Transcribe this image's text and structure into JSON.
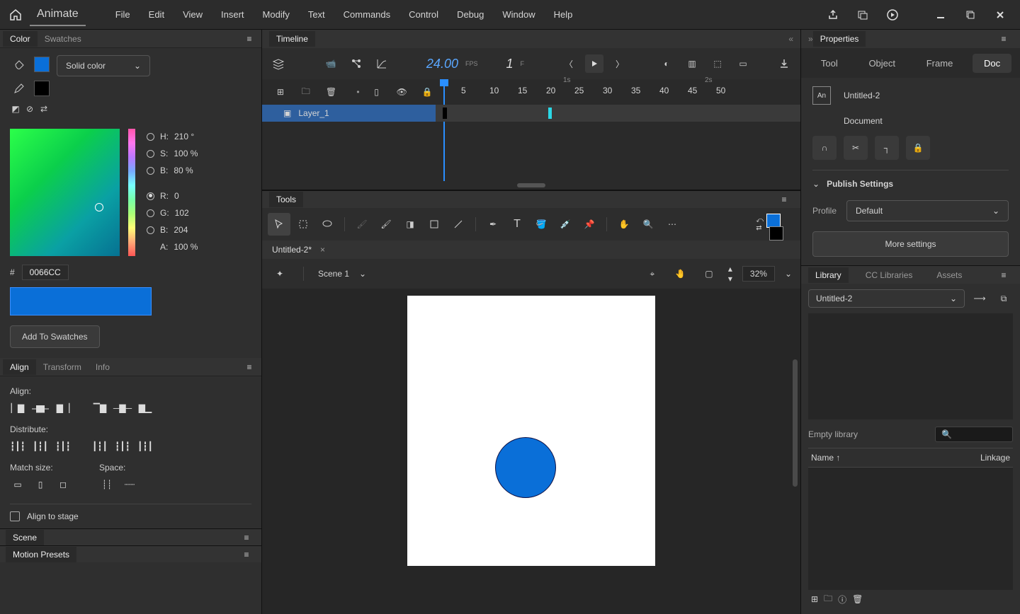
{
  "app": {
    "name": "Animate"
  },
  "menu": [
    "File",
    "Edit",
    "View",
    "Insert",
    "Modify",
    "Text",
    "Commands",
    "Control",
    "Debug",
    "Window",
    "Help"
  ],
  "color": {
    "panel_tab": "Color",
    "swatches_tab": "Swatches",
    "type": "Solid color",
    "hex_prefix": "#",
    "hex": "0066CC",
    "H_label": "H:",
    "H_val": "210 °",
    "S_label": "S:",
    "S_val": "100 %",
    "B_label": "B:",
    "B_val": "80 %",
    "R_label": "R:",
    "R_val": "0",
    "G_label": "G:",
    "G_val": "102",
    "Bch_label": "B:",
    "Bch_val": "204",
    "A_label": "A:",
    "A_val": "100 %",
    "add": "Add To Swatches"
  },
  "align": {
    "tab": "Align",
    "transform": "Transform",
    "info": "Info",
    "align_lbl": "Align:",
    "distribute_lbl": "Distribute:",
    "match_lbl": "Match size:",
    "space_lbl": "Space:",
    "stage": "Align to stage"
  },
  "scene": {
    "tab": "Scene"
  },
  "motion": {
    "tab": "Motion Presets"
  },
  "timeline": {
    "tab": "Timeline",
    "fps": "24.00",
    "fps_unit": "FPS",
    "frame": "1",
    "frame_unit": "F",
    "layer": "Layer_1",
    "marks": [
      "5",
      "10",
      "15",
      "20",
      "25",
      "30",
      "35",
      "40",
      "45",
      "50"
    ],
    "mark1s": "1s",
    "mark2s": "2s"
  },
  "tools": {
    "tab": "Tools"
  },
  "doc": {
    "tab": "Untitled-2*",
    "scene": "Scene 1",
    "zoom": "32%"
  },
  "props": {
    "tab": "Properties",
    "tool": "Tool",
    "object": "Object",
    "frame": "Frame",
    "doc": "Doc",
    "docname": "Untitled-2",
    "doclabel": "Document",
    "publish": "Publish Settings",
    "profile_lbl": "Profile",
    "profile": "Default",
    "more": "More settings"
  },
  "library": {
    "tab": "Library",
    "cc": "CC Libraries",
    "assets": "Assets",
    "docname": "Untitled-2",
    "empty": "Empty library",
    "name": "Name",
    "linkage": "Linkage"
  }
}
